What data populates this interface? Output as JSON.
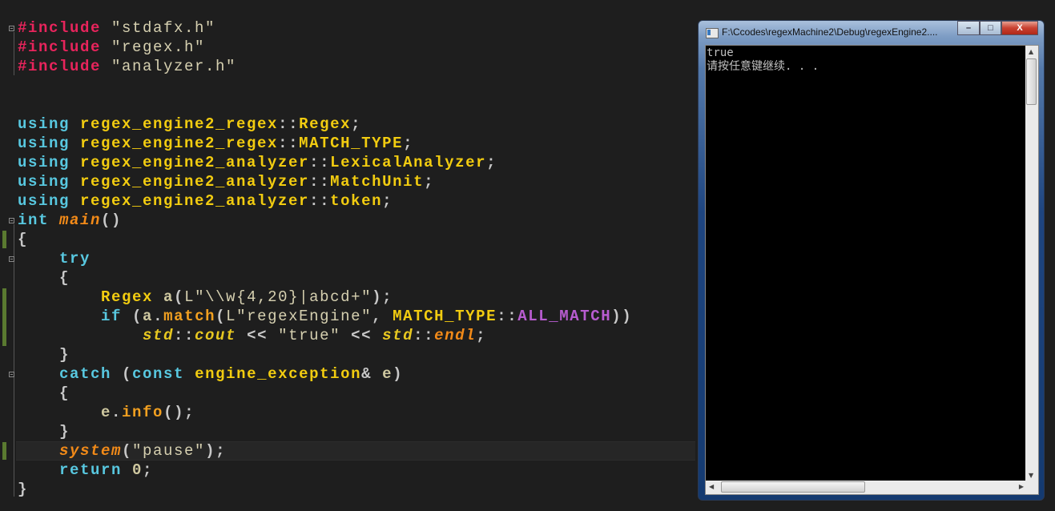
{
  "editor": {
    "lines": [
      [
        [
          "pp",
          "#include"
        ],
        [
          "str",
          " \"stdafx.h\""
        ]
      ],
      [
        [
          "pp",
          "#include"
        ],
        [
          "str",
          " \"regex.h\""
        ]
      ],
      [
        [
          "pp",
          "#include"
        ],
        [
          "str",
          " \"analyzer.h\""
        ]
      ],
      [],
      [],
      [
        [
          "kw",
          "using "
        ],
        [
          "ty",
          "regex_engine2_regex"
        ],
        [
          "op",
          "::"
        ],
        [
          "ty",
          "Regex"
        ],
        [
          "op",
          ";"
        ]
      ],
      [
        [
          "kw",
          "using "
        ],
        [
          "ty",
          "regex_engine2_regex"
        ],
        [
          "op",
          "::"
        ],
        [
          "ty",
          "MATCH_TYPE"
        ],
        [
          "op",
          ";"
        ]
      ],
      [
        [
          "kw",
          "using "
        ],
        [
          "ty",
          "regex_engine2_analyzer"
        ],
        [
          "op",
          "::"
        ],
        [
          "ty",
          "LexicalAnalyzer"
        ],
        [
          "op",
          ";"
        ]
      ],
      [
        [
          "kw",
          "using "
        ],
        [
          "ty",
          "regex_engine2_analyzer"
        ],
        [
          "op",
          "::"
        ],
        [
          "ty",
          "MatchUnit"
        ],
        [
          "op",
          ";"
        ]
      ],
      [
        [
          "kw",
          "using "
        ],
        [
          "ty",
          "regex_engine2_analyzer"
        ],
        [
          "op",
          "::"
        ],
        [
          "ty",
          "token"
        ],
        [
          "op",
          ";"
        ]
      ],
      [
        [
          "kw",
          "int "
        ],
        [
          "fn",
          "main"
        ],
        [
          "op",
          "()"
        ]
      ],
      [
        [
          "op",
          "{"
        ]
      ],
      [
        [
          "kw",
          "    try"
        ]
      ],
      [
        [
          "op",
          "    {"
        ]
      ],
      [
        [
          "ty",
          "        Regex "
        ],
        [
          "id",
          "a"
        ],
        [
          "op",
          "("
        ],
        [
          "str",
          "L\"\\\\w{4,20}|abcd+\""
        ],
        [
          "op",
          ");"
        ]
      ],
      [
        [
          "kw",
          "        if "
        ],
        [
          "op",
          "("
        ],
        [
          "id",
          "a"
        ],
        [
          "op",
          "."
        ],
        [
          "mf",
          "match"
        ],
        [
          "op",
          "("
        ],
        [
          "str",
          "L\"regexEngine\""
        ],
        [
          "op",
          ", "
        ],
        [
          "ty",
          "MATCH_TYPE"
        ],
        [
          "op",
          "::"
        ],
        [
          "en",
          "ALL_MATCH"
        ],
        [
          "op",
          "))"
        ]
      ],
      [
        [
          "ns",
          "            std"
        ],
        [
          "op",
          "::"
        ],
        [
          "ns",
          "cout"
        ],
        [
          "op",
          " << "
        ],
        [
          "str",
          "\"true\""
        ],
        [
          "op",
          " << "
        ],
        [
          "ns",
          "std"
        ],
        [
          "op",
          "::"
        ],
        [
          "fn",
          "endl"
        ],
        [
          "op",
          ";"
        ]
      ],
      [
        [
          "op",
          "    }"
        ]
      ],
      [
        [
          "kw",
          "    catch "
        ],
        [
          "op",
          "("
        ],
        [
          "kw",
          "const "
        ],
        [
          "ty",
          "engine_exception"
        ],
        [
          "op",
          "& "
        ],
        [
          "id",
          "e"
        ],
        [
          "op",
          ")"
        ]
      ],
      [
        [
          "op",
          "    {"
        ]
      ],
      [
        [
          "id",
          "        e"
        ],
        [
          "op",
          "."
        ],
        [
          "mf",
          "info"
        ],
        [
          "op",
          "();"
        ]
      ],
      [
        [
          "op",
          "    }"
        ]
      ],
      [
        [
          "fn",
          "    system"
        ],
        [
          "op",
          "("
        ],
        [
          "str",
          "\"pause\""
        ],
        [
          "op",
          ");"
        ]
      ],
      [
        [
          "kw",
          "    return "
        ],
        [
          "id",
          "0"
        ],
        [
          "op",
          ";"
        ]
      ],
      [
        [
          "op",
          "}"
        ]
      ]
    ]
  },
  "console": {
    "title": "F:\\Ccodes\\regexMachine2\\Debug\\regexEngine2....",
    "min_label": "–",
    "max_label": "□",
    "close_label": "X",
    "output": [
      "true",
      "请按任意键继续. . ."
    ],
    "scroll_up": "▲",
    "scroll_down": "▼",
    "scroll_left": "◀",
    "scroll_right": "▶"
  }
}
